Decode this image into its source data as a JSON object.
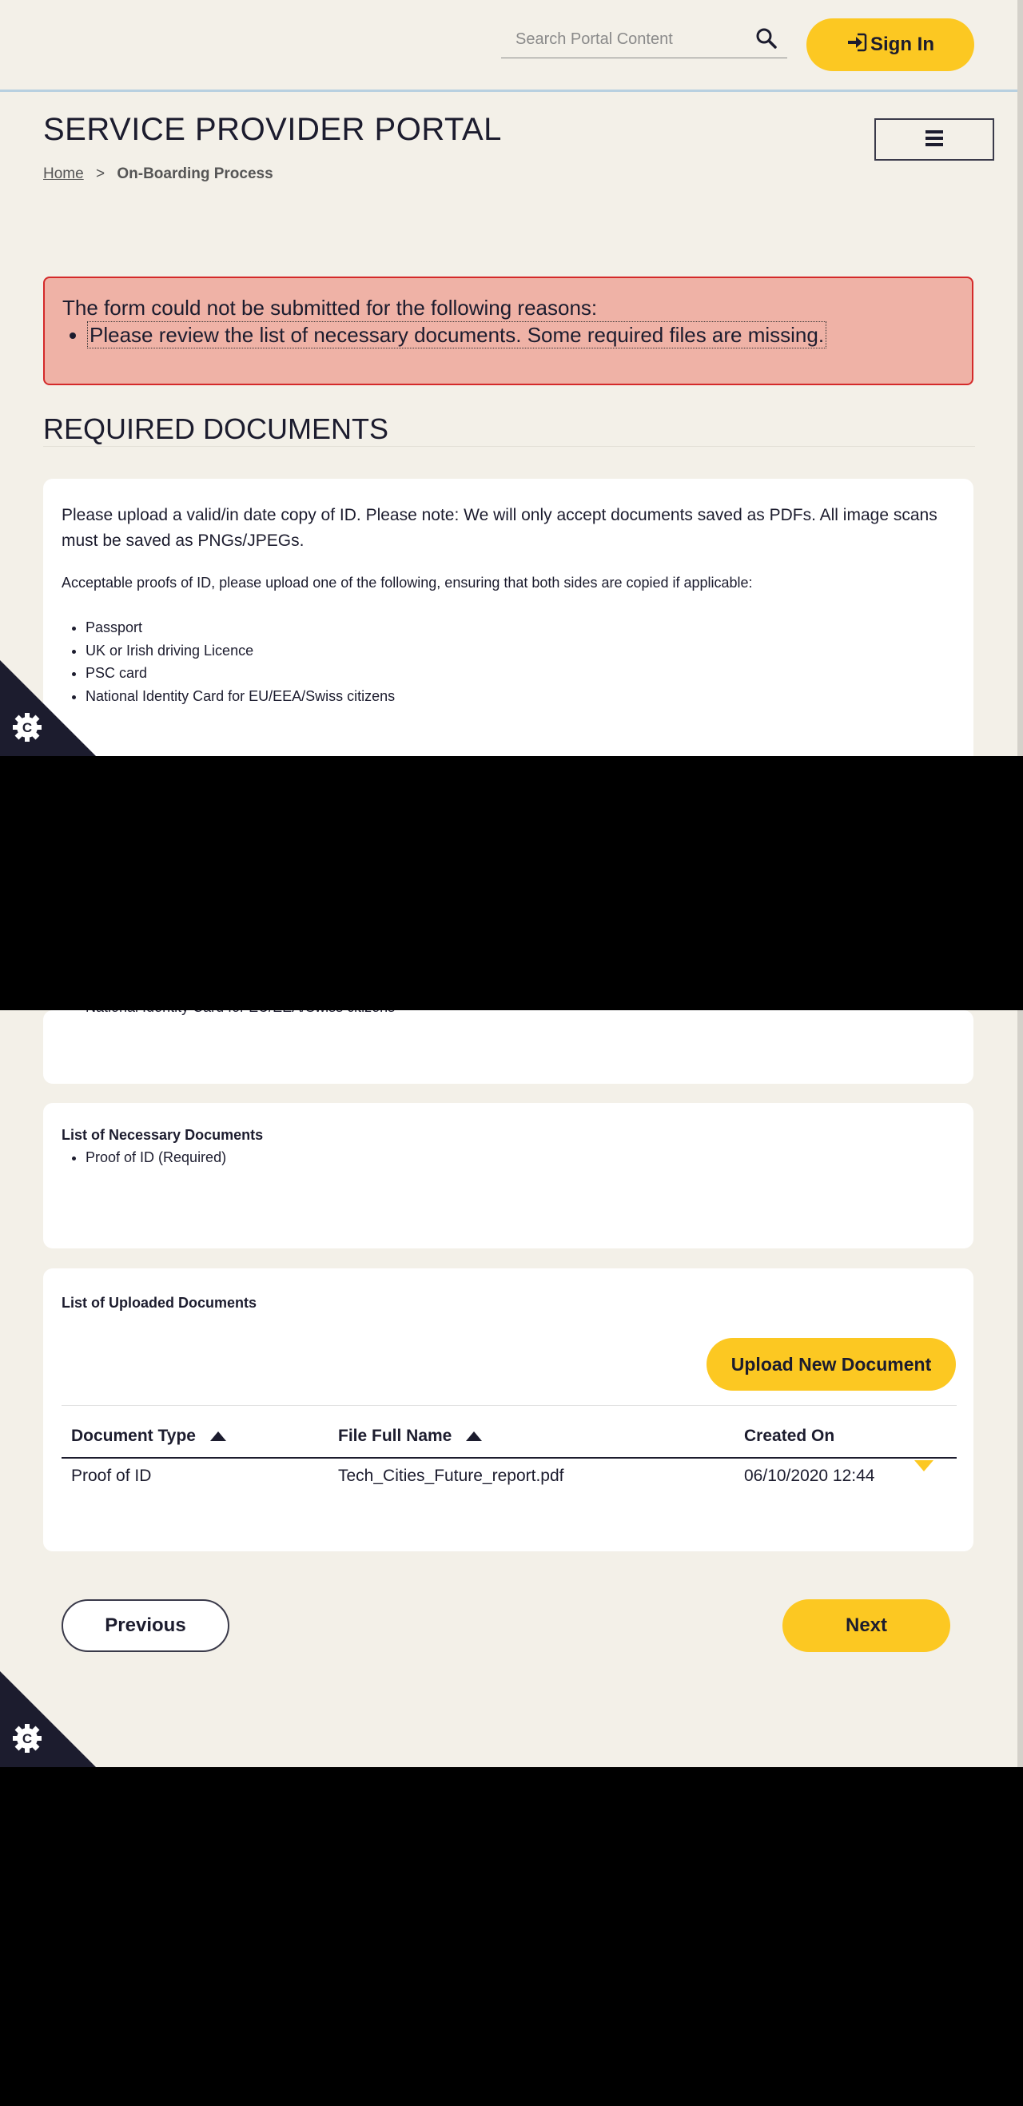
{
  "header": {
    "search_placeholder": "Search Portal Content",
    "sign_in_label": "Sign In",
    "portal_title": "SERVICE PROVIDER PORTAL"
  },
  "breadcrumb": {
    "home": "Home",
    "separator": ">",
    "current": "On-Boarding Process"
  },
  "alert": {
    "heading": "The form could not be submitted for the following reasons:",
    "items": [
      "Please review the list of necessary documents. Some required files are missing."
    ]
  },
  "section": {
    "title": "REQUIRED DOCUMENTS"
  },
  "id_card": {
    "intro": "Please upload a valid/in date copy of ID. Please note: We will only accept documents saved as PDFs. All image scans must be saved as PNGs/JPEGs.",
    "acceptable": "Acceptable proofs of ID, please upload one of the following, ensuring that both sides are copied if applicable:",
    "items": [
      "Passport",
      "UK or Irish driving Licence",
      "PSC card",
      "National Identity Card for EU/EEA/Swiss citizens"
    ]
  },
  "necessary": {
    "title": "List of Necessary Documents",
    "items": [
      "Proof of ID (Required)"
    ]
  },
  "uploaded": {
    "title": "List of Uploaded Documents",
    "upload_label": "Upload New Document",
    "columns": [
      "Document Type",
      "File Full Name",
      "Created On"
    ],
    "rows": [
      {
        "type": "Proof of ID",
        "file": "Tech_Cities_Future_report.pdf",
        "created": "06/10/2020 12:44"
      }
    ]
  },
  "nav": {
    "previous": "Previous",
    "next": "Next"
  },
  "icons": {
    "search": "search-icon",
    "sign_in": "sign-in-icon",
    "menu": "hamburger-menu-icon",
    "sort": "sort-ascending-icon",
    "row_expand": "chevron-down-icon",
    "cookie": "cookie-settings-gear-icon"
  },
  "colors": {
    "page_bg": "#f3f0e8",
    "accent": "#fcc822",
    "alert_bg": "#efb2a6",
    "alert_border": "#d42a2a",
    "text": "#1c1c2e"
  }
}
